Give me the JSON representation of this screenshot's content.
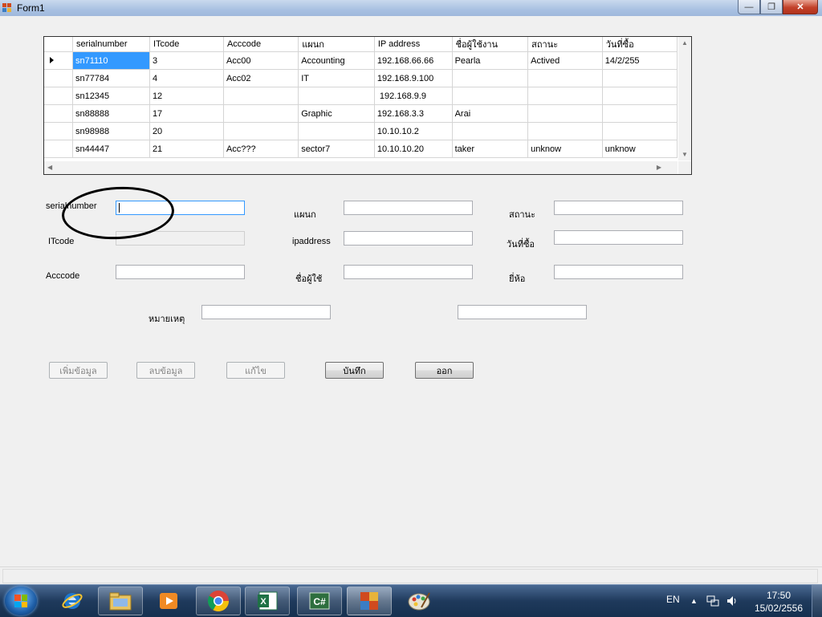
{
  "window": {
    "title": "Form1",
    "minimize": "—",
    "maximize": "❐",
    "close": "✕"
  },
  "grid": {
    "columns": [
      "serialnumber",
      "ITcode",
      "Acccode",
      "แผนก",
      "IP address",
      "ชื่อผู้ใช้งาน",
      "สถานะ",
      "วันที่ซื้อ"
    ],
    "rows": [
      [
        "sn71110",
        "3",
        "Acc00",
        "Accounting",
        "192.168.66.66",
        "Pearla",
        "Actived",
        "14/2/255"
      ],
      [
        "sn77784",
        "4",
        "Acc02",
        "IT",
        "192.168.9.100",
        "",
        "",
        ""
      ],
      [
        "sn12345",
        "12",
        "",
        "",
        " 192.168.9.9",
        "",
        "",
        ""
      ],
      [
        "sn88888",
        "17",
        "",
        "Graphic",
        "192.168.3.3",
        "Arai",
        "",
        ""
      ],
      [
        "sn98988",
        "20",
        "",
        "",
        "10.10.10.2",
        "",
        "",
        ""
      ],
      [
        "sn44447",
        "21",
        "Acc???",
        "sector7",
        "10.10.10.20",
        "taker",
        "unknow",
        "unknow"
      ]
    ],
    "selected_row": 0
  },
  "form": {
    "labels": {
      "serialnumber": "serialnumber",
      "itcode": "ITcode",
      "acccode": "Acccode",
      "department": "แผนก",
      "ipaddress": "ipaddress",
      "username": "ชื่อผู้ใช้",
      "status": "สถานะ",
      "purchase_date": "วันที่ซื้อ",
      "brand": "ยี่ห้อ",
      "note": "หมายเหตุ"
    },
    "values": {
      "serialnumber": "",
      "itcode": "",
      "acccode": "",
      "department": "",
      "ipaddress": "",
      "username": "",
      "status": "",
      "purchase_date": "",
      "brand": "",
      "note": "",
      "extra": ""
    }
  },
  "buttons": {
    "add": "เพิ่มข้อมูล",
    "delete": "ลบข้อมูล",
    "edit": "แก้ไข",
    "save": "บันทึก",
    "exit": "ออก"
  },
  "taskbar": {
    "items": [
      "ie-icon",
      "explorer-icon",
      "media-player-icon",
      "chrome-icon",
      "excel-icon",
      "csharp-icon",
      "form-app-icon",
      "paint-icon"
    ],
    "language": "EN",
    "time": "17:50",
    "date": "15/02/2556"
  }
}
